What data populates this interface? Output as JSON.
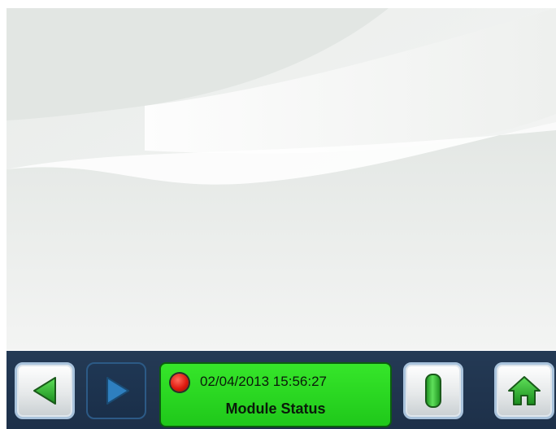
{
  "status": {
    "datetime": "02/04/2013  15:56:27",
    "title": "Module Status",
    "led_color": "#e01a10",
    "panel_color": "#2ed824"
  },
  "nav": {
    "back": {
      "icon": "back-arrow-icon",
      "enabled": true
    },
    "forward": {
      "icon": "forward-arrow-icon",
      "enabled": false
    },
    "info": {
      "icon": "info-bar-icon",
      "enabled": true
    },
    "home": {
      "icon": "home-icon",
      "enabled": true
    }
  },
  "colors": {
    "accent_green": "#2bbd2b",
    "bar_background": "#203550"
  }
}
